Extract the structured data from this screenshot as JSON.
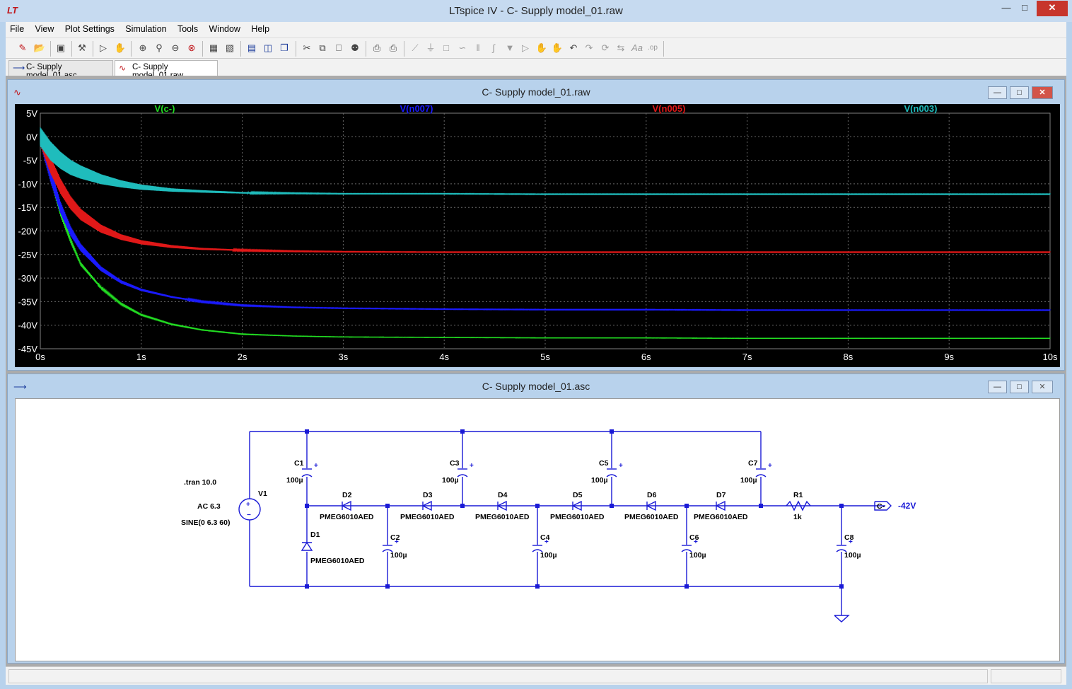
{
  "app": {
    "title": "LTspice IV - C- Supply model_01.raw",
    "logo_icon": "ltspice-logo-icon"
  },
  "menu": [
    "File",
    "View",
    "Plot Settings",
    "Simulation",
    "Tools",
    "Window",
    "Help"
  ],
  "tabs": [
    {
      "label": "C- Supply model_01.asc",
      "icon": "schematic-icon"
    },
    {
      "label": "C- Supply model_01.raw",
      "icon": "waveform-icon"
    }
  ],
  "plot_window": {
    "title": "C- Supply model_01.raw"
  },
  "schematic_window": {
    "title": "C- Supply model_01.asc"
  },
  "chart_data": {
    "type": "line",
    "background": "#000000",
    "grid": true,
    "xlabel": "",
    "ylabel": "",
    "xlim": [
      0,
      10
    ],
    "ylim": [
      -45,
      5
    ],
    "x_ticks": [
      "0s",
      "1s",
      "2s",
      "3s",
      "4s",
      "5s",
      "6s",
      "7s",
      "8s",
      "9s",
      "10s"
    ],
    "y_ticks": [
      "5V",
      "0V",
      "-5V",
      "-10V",
      "-15V",
      "-20V",
      "-25V",
      "-30V",
      "-35V",
      "-40V",
      "-45V"
    ],
    "series": [
      {
        "name": "V(c-)",
        "color": "#22dd22",
        "x": [
          0,
          0.1,
          0.2,
          0.3,
          0.4,
          0.6,
          0.8,
          1.0,
          1.3,
          1.6,
          2.0,
          2.5,
          3.0,
          4,
          5,
          6,
          7,
          8,
          9,
          10
        ],
        "y": [
          0,
          -8,
          -16,
          -22,
          -27,
          -32,
          -35.5,
          -37.8,
          -39.8,
          -41,
          -41.9,
          -42.3,
          -42.5,
          -42.6,
          -42.7,
          -42.7,
          -42.8,
          -42.8,
          -42.8,
          -42.8
        ],
        "ripple": [
          3,
          2.5,
          1.8,
          1.2,
          0.8,
          0.4,
          0.3,
          0.2,
          0.15,
          0.1,
          0.1,
          0.05,
          0.05,
          0.05,
          0.05,
          0.05,
          0.05,
          0.05,
          0.05,
          0.05
        ]
      },
      {
        "name": "V(n007)",
        "color": "#1a1aff",
        "x": [
          0,
          0.1,
          0.2,
          0.3,
          0.4,
          0.6,
          0.8,
          1.0,
          1.3,
          1.6,
          2.0,
          2.5,
          3.0,
          4,
          5,
          6,
          7,
          8,
          9,
          10
        ],
        "y": [
          0,
          -8,
          -15,
          -20,
          -23.5,
          -28,
          -30.8,
          -32.5,
          -34,
          -35,
          -35.8,
          -36.2,
          -36.4,
          -36.6,
          -36.7,
          -36.7,
          -36.8,
          -36.8,
          -36.8,
          -36.8
        ],
        "ripple": [
          3,
          3,
          2.5,
          2,
          1.6,
          1,
          0.7,
          0.5,
          0.35,
          0.25,
          0.2,
          0.1,
          0.1,
          0.1,
          0.1,
          0.1,
          0.1,
          0.1,
          0.1,
          0.1
        ]
      },
      {
        "name": "V(n005)",
        "color": "#e01818",
        "x": [
          0,
          0.1,
          0.2,
          0.3,
          0.4,
          0.6,
          0.8,
          1.0,
          1.3,
          1.6,
          2.0,
          2.5,
          3.0,
          4,
          5,
          6,
          7,
          8,
          9,
          10
        ],
        "y": [
          0,
          -6,
          -10.5,
          -14,
          -16.5,
          -19.5,
          -21.3,
          -22.4,
          -23.3,
          -23.8,
          -24.1,
          -24.3,
          -24.4,
          -24.5,
          -24.5,
          -24.5,
          -24.5,
          -24.5,
          -24.5,
          -24.5
        ],
        "ripple": [
          3.5,
          3.5,
          3.2,
          2.8,
          2.4,
          1.7,
          1.2,
          0.9,
          0.6,
          0.4,
          0.25,
          0.15,
          0.1,
          0.1,
          0.1,
          0.1,
          0.1,
          0.1,
          0.1,
          0.1
        ]
      },
      {
        "name": "V(n003)",
        "color": "#1fbcbc",
        "x": [
          0,
          0.1,
          0.2,
          0.3,
          0.4,
          0.6,
          0.8,
          1.0,
          1.3,
          1.6,
          2.0,
          2.5,
          3.0,
          4,
          5,
          6,
          7,
          8,
          9,
          10
        ],
        "y": [
          0,
          -3,
          -5,
          -6.5,
          -7.5,
          -9,
          -10,
          -10.7,
          -11.3,
          -11.6,
          -11.9,
          -12,
          -12.1,
          -12.1,
          -12.2,
          -12.2,
          -12.2,
          -12.2,
          -12.2,
          -12.2
        ],
        "ripple": [
          4,
          4,
          3.6,
          3.2,
          2.8,
          2.1,
          1.5,
          1.1,
          0.7,
          0.5,
          0.3,
          0.15,
          0.1,
          0.1,
          0.1,
          0.1,
          0.1,
          0.1,
          0.1,
          0.1
        ]
      }
    ]
  },
  "schematic": {
    "directive": ".tran 10.0",
    "source": {
      "ref": "V1",
      "ac": "AC 6.3",
      "sine": "SINE(0 6.3 60)"
    },
    "capacitors": [
      {
        "ref": "C1",
        "value": "100µ"
      },
      {
        "ref": "C2",
        "value": "100µ"
      },
      {
        "ref": "C3",
        "value": "100µ"
      },
      {
        "ref": "C4",
        "value": "100µ"
      },
      {
        "ref": "C5",
        "value": "100µ"
      },
      {
        "ref": "C6",
        "value": "100µ"
      },
      {
        "ref": "C7",
        "value": "100µ"
      },
      {
        "ref": "C8",
        "value": "100µ"
      }
    ],
    "diodes": [
      {
        "ref": "D1",
        "value": "PMEG6010AED"
      },
      {
        "ref": "D2",
        "value": "PMEG6010AED"
      },
      {
        "ref": "D3",
        "value": "PMEG6010AED"
      },
      {
        "ref": "D4",
        "value": "PMEG6010AED"
      },
      {
        "ref": "D5",
        "value": "PMEG6010AED"
      },
      {
        "ref": "D6",
        "value": "PMEG6010AED"
      },
      {
        "ref": "D7",
        "value": "PMEG6010AED"
      }
    ],
    "resistor": {
      "ref": "R1",
      "value": "1k"
    },
    "port": {
      "label": "C-",
      "value": "-42V"
    }
  }
}
